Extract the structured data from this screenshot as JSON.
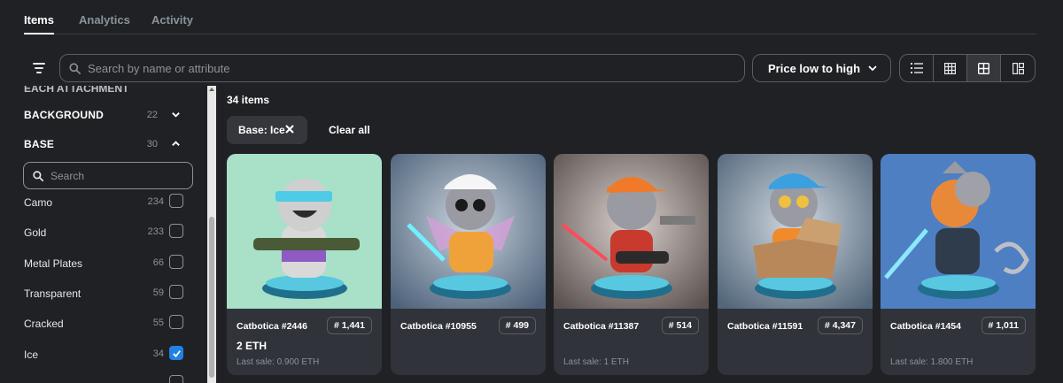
{
  "tabs": [
    {
      "label": "Items"
    },
    {
      "label": "Analytics"
    },
    {
      "label": "Activity"
    }
  ],
  "toolbar": {
    "search_placeholder": "Search by name or attribute",
    "sort_label": "Price low to high",
    "views": [
      "list-view-icon",
      "grid-small-icon",
      "grid-large-icon",
      "grid-compact-icon"
    ],
    "active_view": "grid-large-icon"
  },
  "sidebar": {
    "cut_heading": "EACH ATTACHMENT",
    "background": {
      "label": "BACKGROUND",
      "count": "22"
    },
    "base": {
      "label": "BASE",
      "count": "30"
    },
    "search_placeholder": "Search",
    "options": [
      {
        "label": "Camo",
        "count": "234",
        "checked": false
      },
      {
        "label": "Gold",
        "count": "233",
        "checked": false
      },
      {
        "label": "Metal Plates",
        "count": "66",
        "checked": false
      },
      {
        "label": "Transparent",
        "count": "59",
        "checked": false
      },
      {
        "label": "Cracked",
        "count": "55",
        "checked": false
      },
      {
        "label": "Ice",
        "count": "34",
        "checked": true
      }
    ]
  },
  "main": {
    "item_count": "34 items",
    "chip_label": "Base: Ice",
    "clear_all": "Clear all"
  },
  "cards": [
    {
      "name": "Catbotica #2446",
      "rank": "# 1,441",
      "price": "2 ETH",
      "last_sale": "Last sale: 0.900 ETH",
      "bg": "#a8e0c8"
    },
    {
      "name": "Catbotica #10955",
      "rank": "# 499",
      "price": "",
      "last_sale": "",
      "bg": "#5a6e86"
    },
    {
      "name": "Catbotica #11387",
      "rank": "# 514",
      "price": "",
      "last_sale": "Last sale: 1 ETH",
      "bg": "#6a6260"
    },
    {
      "name": "Catbotica #11591",
      "rank": "# 4,347",
      "price": "",
      "last_sale": "",
      "bg": "#5c6f82"
    },
    {
      "name": "Catbotica #1454",
      "rank": "# 1,011",
      "price": "",
      "last_sale": "Last sale: 1.800 ETH",
      "bg": "#4e7fc2"
    }
  ],
  "colors": {
    "background": "#202125",
    "card": "#303339",
    "accent": "#2081e2",
    "muted_text": "#8a939b"
  }
}
